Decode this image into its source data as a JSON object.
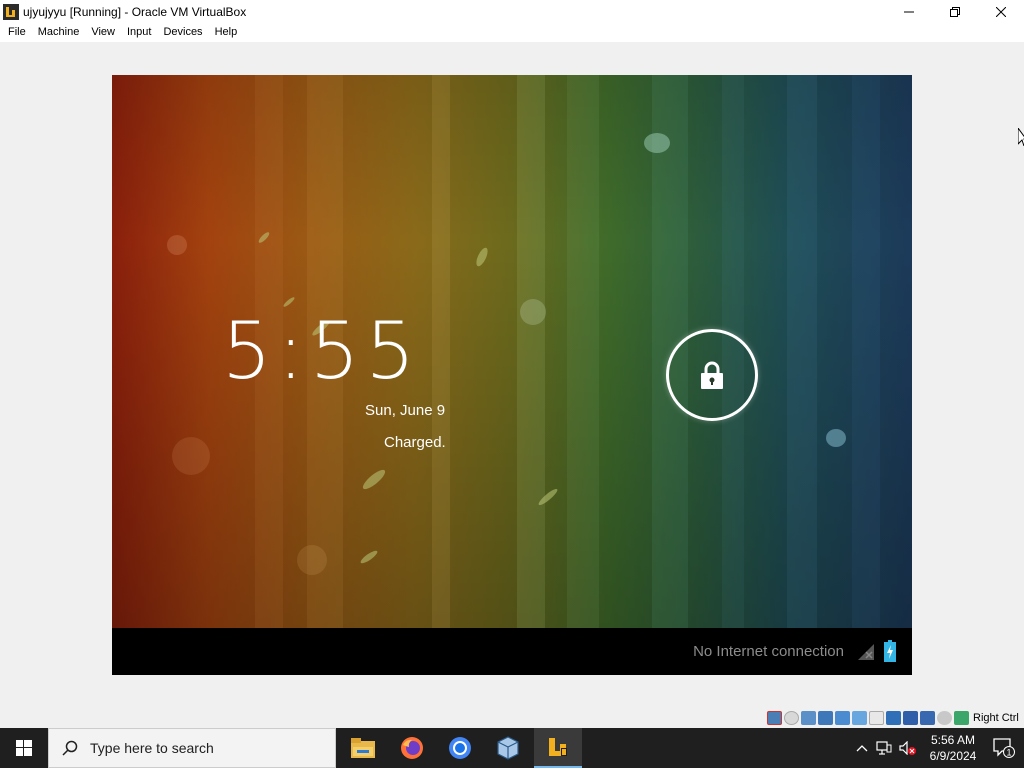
{
  "window": {
    "title": "ujyujyyu [Running] - Oracle VM VirtualBox",
    "icon": "virtualbox-vm-icon",
    "controls": [
      "minimize-icon",
      "maximize-icon",
      "close-icon"
    ]
  },
  "menubar": {
    "items": [
      {
        "label": "File"
      },
      {
        "label": "Machine"
      },
      {
        "label": "View"
      },
      {
        "label": "Input"
      },
      {
        "label": "Devices"
      },
      {
        "label": "Help"
      }
    ]
  },
  "android": {
    "lockscreen": {
      "time": "5:55",
      "date": "Sun, June 9",
      "battery_status": "Charged.",
      "unlock_icon": "lock-icon"
    },
    "statusbar": {
      "network_text": "No Internet connection",
      "icons": [
        "signal-icon",
        "battery-charging-icon"
      ]
    }
  },
  "vbox_status": {
    "host_key": "Right Ctrl",
    "icons": [
      "hard-disk-icon",
      "optical-drive-icon",
      "audio-icon",
      "network-icon",
      "usb-icon",
      "shared-folder-icon",
      "display-icon",
      "video-capture-icon",
      "cpu-icon",
      "mouse-integration-icon",
      "keyboard-icon"
    ]
  },
  "taskbar": {
    "search_placeholder": "Type here to search",
    "apps": [
      "file-explorer-icon",
      "firefox-icon",
      "chrome-icon",
      "virtualbox-icon",
      "virtualbox-vm-icon"
    ],
    "time": "5:56 AM",
    "date": "6/9/2024",
    "notification_count": "1"
  },
  "colors": {
    "taskbar_bg": "#1f1f1f",
    "active_underline": "#76b9ed",
    "android_statusbar": "#000000"
  }
}
